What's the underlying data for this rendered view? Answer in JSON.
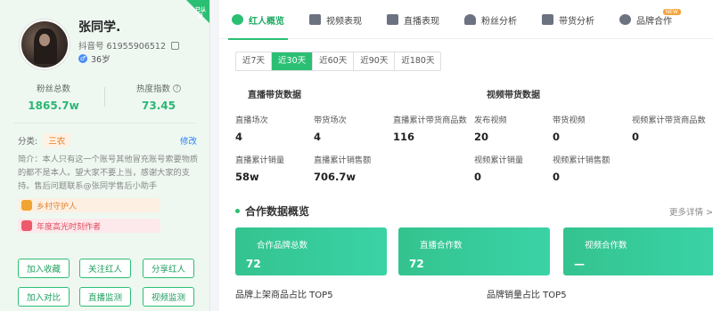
{
  "profile": {
    "corner_tag": "已认证",
    "name": "张同学.",
    "douyin_id": "抖音号 61955906512",
    "age": "36岁",
    "gender_symbol": "♂",
    "fans_label": "粉丝总数",
    "fans_value": "1865.7w",
    "hot_label": "热度指数",
    "hot_value": "73.45",
    "category_label": "分类:",
    "category_value": "三农",
    "edit_label": "修改",
    "bio": "简介：本人只有这一个账号其他冒充账号索要物质的都不是本人。望大家不要上当，感谢大家的支持。售后问题联系@张同学售后小助手",
    "badges": [
      "乡村守护人",
      "年度高光时刻作者"
    ],
    "actions": [
      "加入收藏",
      "关注红人",
      "分享红人",
      "加入对比",
      "直播监测",
      "视频监测"
    ]
  },
  "tabs": [
    {
      "label": "红人概览",
      "icon": "pie-chart-icon"
    },
    {
      "label": "视频表现",
      "icon": "video-icon"
    },
    {
      "label": "直播表现",
      "icon": "live-icon"
    },
    {
      "label": "粉丝分析",
      "icon": "fans-icon"
    },
    {
      "label": "带货分析",
      "icon": "goods-icon"
    },
    {
      "label": "品牌合作",
      "icon": "brand-icon",
      "badge": "NEW"
    }
  ],
  "periods": [
    "近7天",
    "近30天",
    "近60天",
    "近90天",
    "近180天"
  ],
  "live": {
    "title": "直播带货数据",
    "sessions_label": "直播场次",
    "sessions_value": "4",
    "goods_sessions_label": "带货场次",
    "goods_sessions_value": "4",
    "total_goods_label": "直播累计带货商品数",
    "total_goods_value": "116",
    "sales_qty_label": "直播累计销量",
    "sales_qty_value": "58w",
    "sales_amt_label": "直播累计销售额",
    "sales_amt_value": "706.7w"
  },
  "video": {
    "title": "视频带货数据",
    "posts_label": "发布视频",
    "posts_value": "20",
    "goods_videos_label": "带货视频",
    "goods_videos_value": "0",
    "total_goods_label": "视频累计带货商品数",
    "total_goods_value": "0",
    "sales_qty_label": "视频累计销量",
    "sales_qty_value": "0",
    "sales_amt_label": "视频累计销售额",
    "sales_amt_value": "0"
  },
  "overview": {
    "title": "合作数据概览",
    "more": "更多详情 >",
    "cards": [
      {
        "label": "合作品牌总数",
        "value": "72"
      },
      {
        "label": "直播合作数",
        "value": "72"
      },
      {
        "label": "视频合作数",
        "value": "—"
      }
    ],
    "bottom_left": "品牌上架商品占比 TOP5",
    "bottom_right": "品牌销量占比 TOP5"
  },
  "colors": {
    "accent": "#2bbf74",
    "orange": "#e67b22",
    "link": "#2a7ff5"
  }
}
